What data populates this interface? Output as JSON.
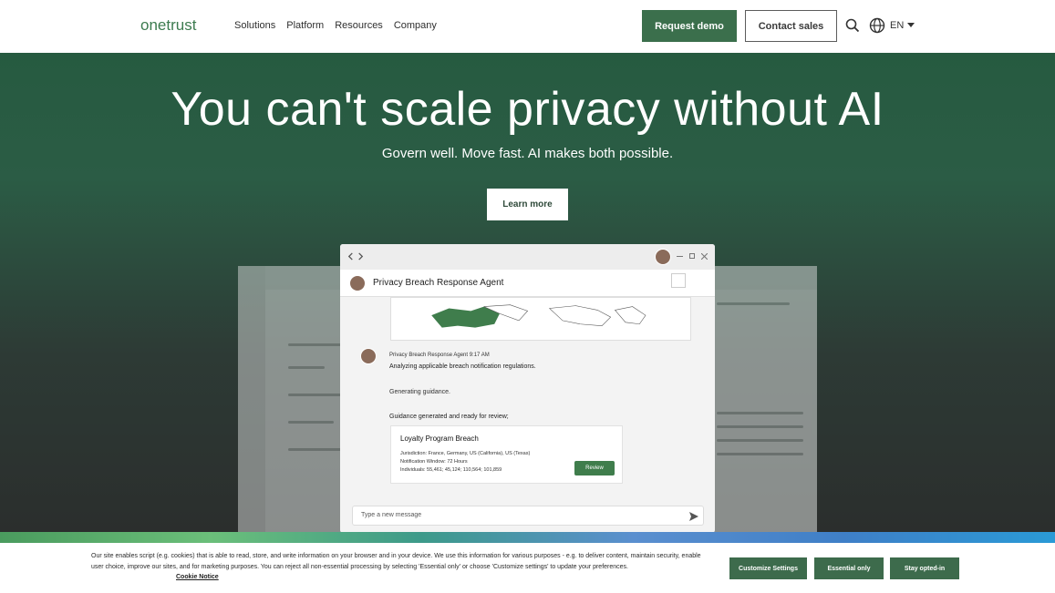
{
  "nav": {
    "logo_text": "onetrust",
    "links": [
      "Solutions",
      "Platform",
      "Resources",
      "Company"
    ],
    "request_demo": "Request demo",
    "contact_sales": "Contact sales",
    "language": "EN",
    "icons": [
      "search-icon",
      "globe-icon",
      "caret-down-icon"
    ]
  },
  "hero": {
    "title": "You can't scale privacy without AI",
    "subtitle": "Govern well. Move fast. AI makes both possible.",
    "cta": "Learn more"
  },
  "agent_window": {
    "title": "Privacy Breach Response Agent",
    "meta": "Privacy Breach Response Agent   9:17 AM",
    "message": "Analyzing applicable breach notification regulations.",
    "generating": "Generating guidance.",
    "ready": "Guidance generated and ready for review;",
    "card": {
      "title": "Loyalty Program Breach",
      "lines": [
        "Jurisdiction: France, Germany, US (California), US (Texas)",
        "Notification Window: 72 Hours",
        "Individuals: 55,461; 45,124; 110,564; 101,859"
      ],
      "button": "Review"
    },
    "input_placeholder": "Type a new message"
  },
  "cookie": {
    "text": "Our site enables script (e.g. cookies) that is able to read, store, and write information on your browser and in your device. We use this information for various purposes - e.g. to deliver content, maintain security, enable user choice, improve our sites, and for marketing purposes. You can reject all non-essential processing by selecting 'Essential only' or choose 'Customize settings' to update your preferences.",
    "notice_link": "Cookie Notice",
    "buttons": {
      "customize": "Customize Settings",
      "essential": "Essential only",
      "opt_in": "Stay opted-in"
    }
  },
  "colors": {
    "brand_green": "#3b6f4c",
    "hero_bg_top": "#245a3e",
    "hero_bg_bottom": "#2a2a2a"
  }
}
